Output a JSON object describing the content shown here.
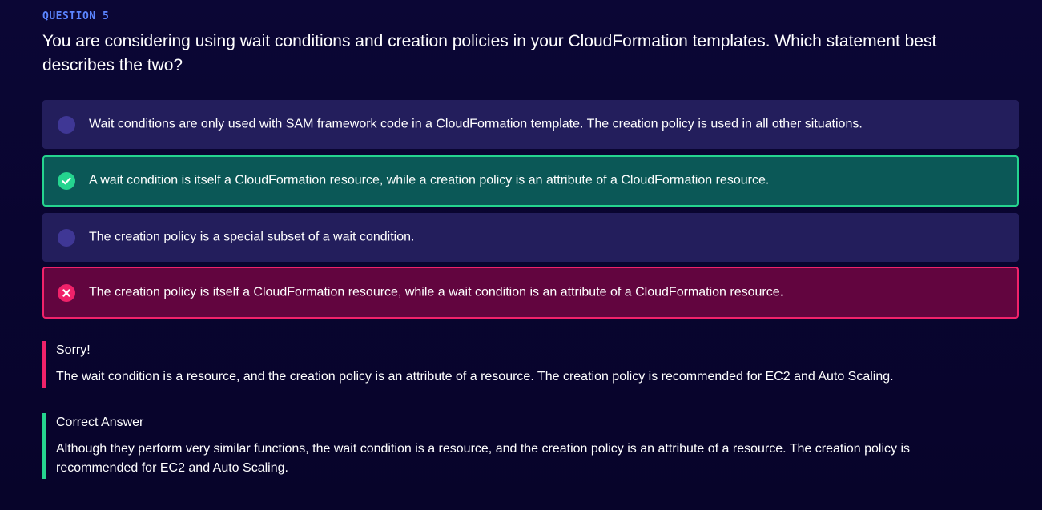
{
  "question": {
    "number_label": "QUESTION 5",
    "text": "You are considering using wait conditions and creation policies in your CloudFormation templates. Which statement best describes the two?"
  },
  "options": [
    {
      "text": "Wait conditions are only used with SAM framework code in a CloudFormation template. The creation policy is used in all other situations.",
      "state": "unselected"
    },
    {
      "text": "A wait condition is itself a CloudFormation resource, while a creation policy is an attribute of a CloudFormation resource.",
      "state": "correct"
    },
    {
      "text": "The creation policy is a special subset of a wait condition.",
      "state": "unselected"
    },
    {
      "text": "The creation policy is itself a CloudFormation resource, while a wait condition is an attribute of a CloudFormation resource.",
      "state": "incorrect"
    }
  ],
  "feedback": {
    "sorry_title": "Sorry!",
    "sorry_text": "The wait condition is a resource, and the creation policy is an attribute of a resource. The creation policy is recommended for EC2 and Auto Scaling.",
    "correct_title": "Correct Answer",
    "correct_text": "Although they perform very similar functions, the wait condition is a resource, and the creation policy is an attribute of a resource. The creation policy is recommended for EC2 and Auto Scaling."
  },
  "colors": {
    "background": "#0b0635",
    "accent_blue": "#5b84ff",
    "option_bg": "#231e5c",
    "correct_bg": "#0b5857",
    "correct_accent": "#25d48f",
    "wrong_bg": "#62053f",
    "wrong_accent": "#f0226a"
  },
  "icons": {
    "correct": "check-circle-icon",
    "incorrect": "x-circle-icon",
    "unselected": "radio-circle-icon"
  }
}
